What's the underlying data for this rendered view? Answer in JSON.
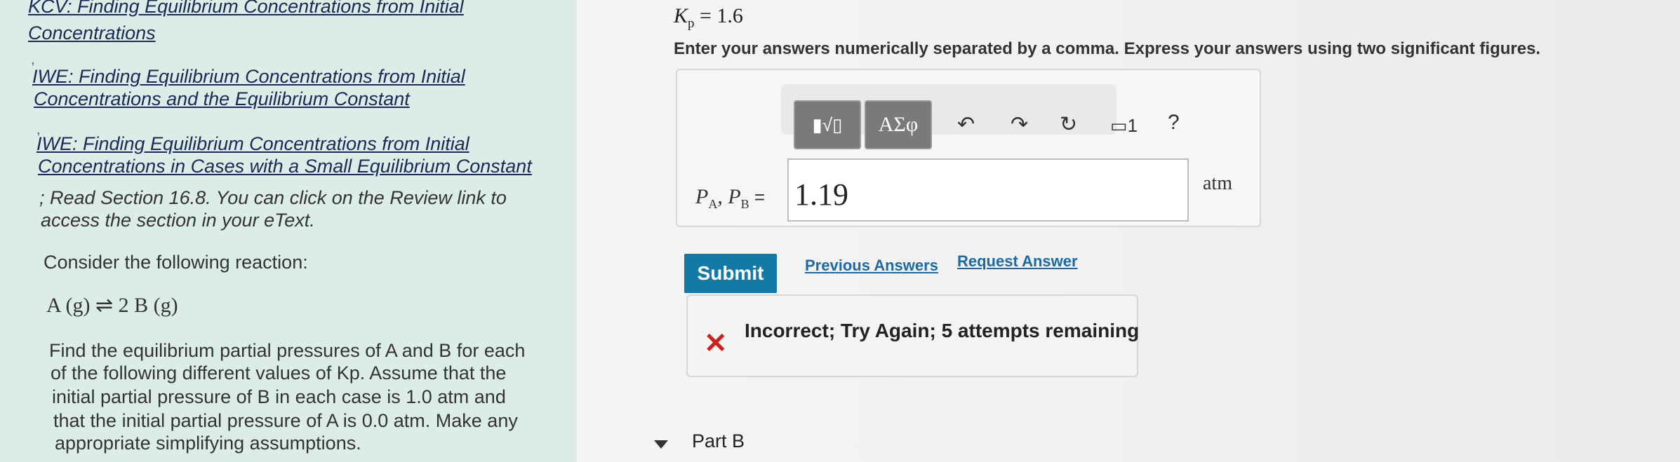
{
  "sidebar": {
    "links": [
      {
        "line1": "KCV: Finding Equilibrium Concentrations from Initial",
        "line2": "Concentrations"
      },
      {
        "line1": "IWE: Finding Equilibrium Concentrations from Initial",
        "line2": "Concentrations and the Equilibrium Constant"
      },
      {
        "line1": "IWE: Finding Equilibrium Concentrations from Initial",
        "line2": "Concentrations in Cases with a Small Equilibrium Constant"
      }
    ],
    "comma": ",",
    "read_note_line1": "; Read Section 16.8. You can click on the Review link to",
    "read_note_line2": "access the section in your eText.",
    "consider": "Consider the following reaction:",
    "reaction": "A (g) ⇌ 2 B (g)",
    "problem_lines": [
      "Find the equilibrium partial pressures of A and B for each",
      "of the following different values of Kp. Assume that the",
      "initial partial pressure of B in each case is 1.0 atm and",
      "that the initial partial pressure of A is 0.0 atm. Make any",
      "appropriate simplifying assumptions."
    ]
  },
  "question": {
    "kp_symbol": "K",
    "kp_sub": "p",
    "kp_value": "= 1.6",
    "instructions": "Enter your answers numerically separated by a comma. Express your answers using two significant figures."
  },
  "toolbar": {
    "math_template": "▮√▯",
    "greek": "ΑΣφ",
    "undo": "↶",
    "redo": "↷",
    "reset": "↻",
    "keyboard_label": "▭1",
    "help": "?"
  },
  "answer": {
    "label_a": "P",
    "label_a_sub": "A",
    "sep": ", ",
    "label_b": "P",
    "label_b_sub": "B",
    "equals": " =",
    "value": "1.19",
    "unit": "atm"
  },
  "actions": {
    "submit": "Submit",
    "previous_answers": "Previous Answers",
    "request_answer": "Request Answer"
  },
  "feedback": {
    "icon": "✕",
    "text": "Incorrect; Try Again; 5 attempts remaining"
  },
  "part_b": {
    "label": "Part B"
  },
  "colors": {
    "sidebar_bg": "#dcece6",
    "submit_bg": "#137aa8",
    "error_red": "#d21d1d",
    "link_blue": "#1a6aa8"
  }
}
